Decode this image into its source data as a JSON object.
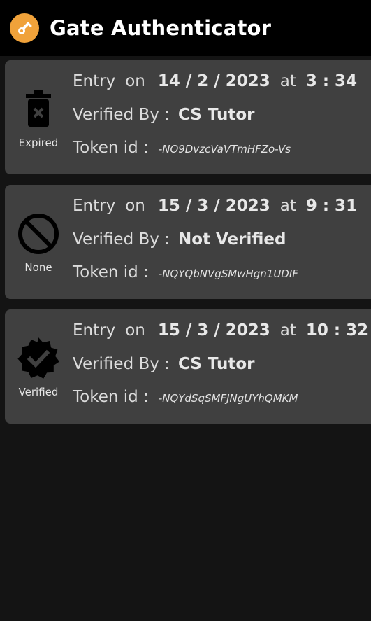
{
  "app": {
    "title": "Gate Authenticator",
    "accent_color": "#f0a23a",
    "logo_icon": "key-icon"
  },
  "labels": {
    "entry": "Entry",
    "on": "on",
    "at": "at",
    "verified_by": "Verified By :",
    "token_id": "Token id :"
  },
  "entries": [
    {
      "status_icon": "trash-icon",
      "status_label": "Expired",
      "date": "14 / 2 / 2023",
      "time": "3 : 34",
      "verified_by": "CS Tutor",
      "token": "-NO9DvzcVaVTmHFZo-Vs"
    },
    {
      "status_icon": "prohibited-icon",
      "status_label": "None",
      "date": "15 / 3 / 2023",
      "time": "9 : 31",
      "verified_by": "Not Verified",
      "token": "-NQYQbNVgSMwHgn1UDIF"
    },
    {
      "status_icon": "verified-badge-icon",
      "status_label": "Verified",
      "date": "15 / 3 / 2023",
      "time": "10 : 32",
      "verified_by": "CS Tutor",
      "token": "-NQYdSqSMFJNgUYhQMKM"
    }
  ]
}
